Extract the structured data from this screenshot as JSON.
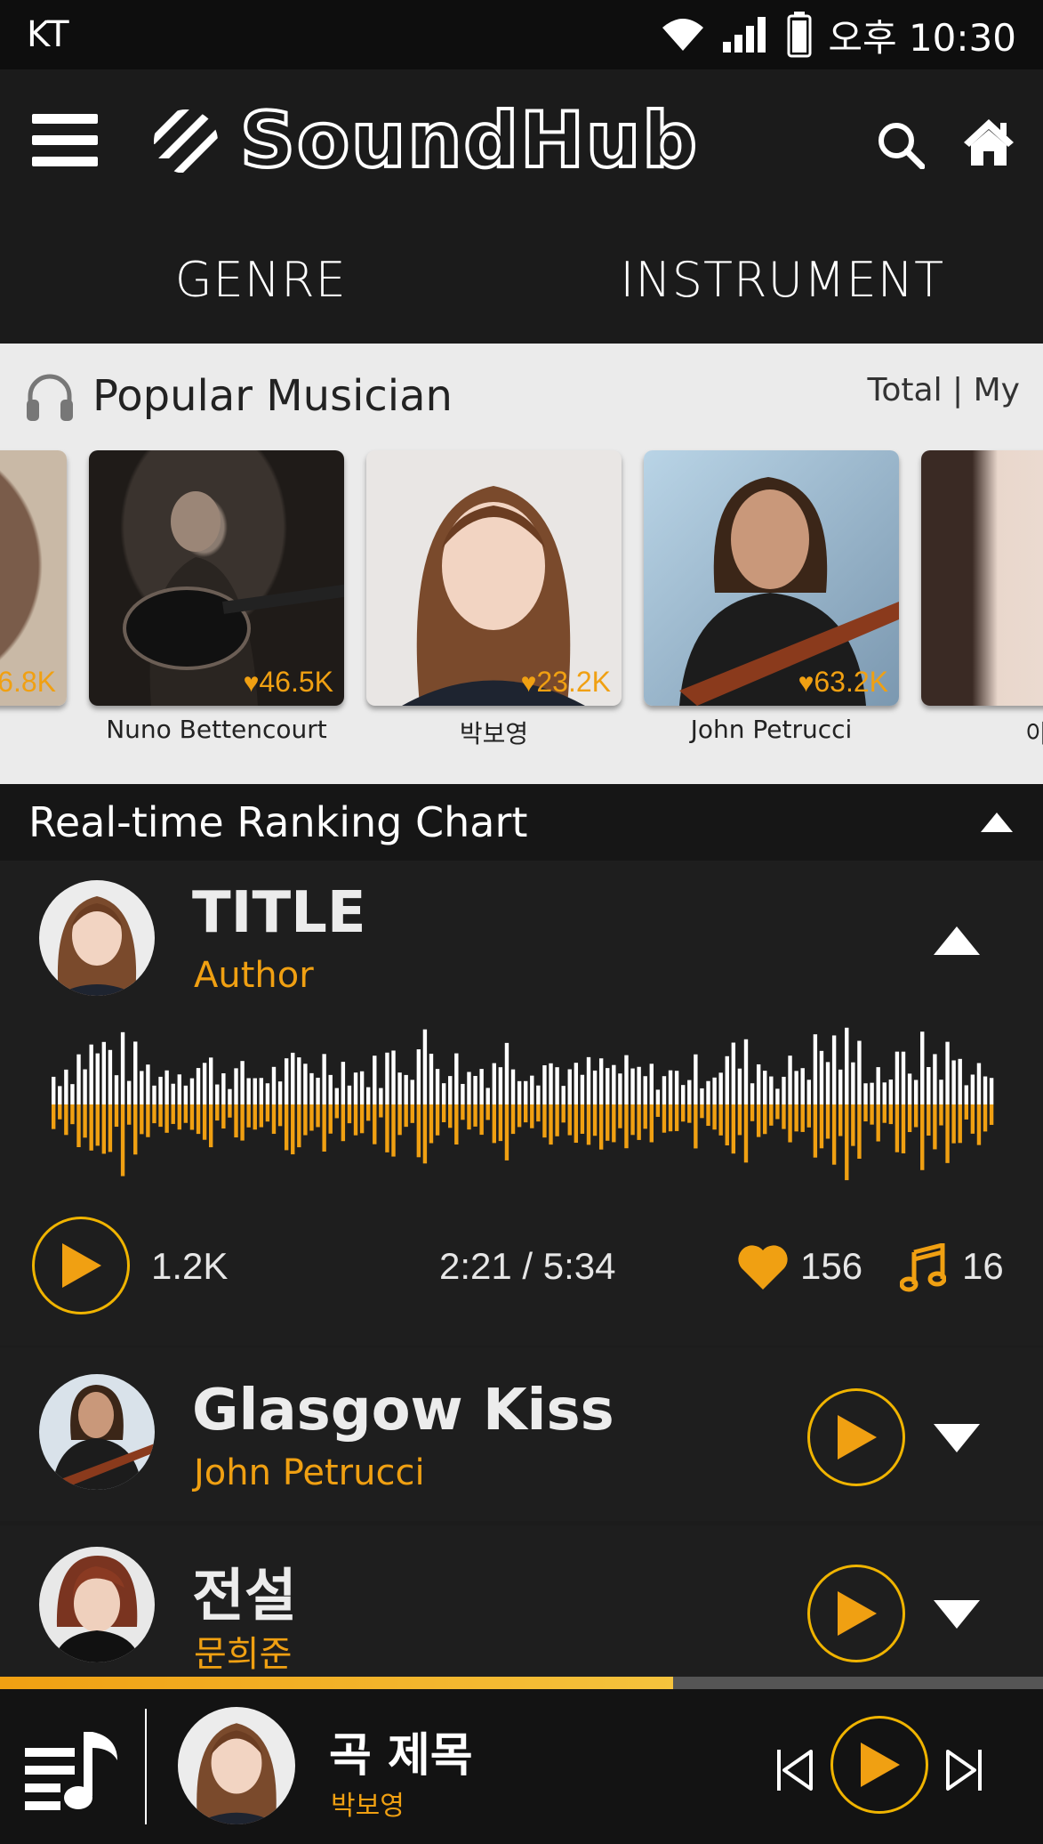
{
  "status_bar": {
    "carrier": "KT",
    "time": "오후 10:30"
  },
  "app": {
    "name": "SoundHub"
  },
  "tabs": [
    {
      "label": "GENRE"
    },
    {
      "label": "INSTRUMENT"
    }
  ],
  "popular": {
    "title": "Popular Musician",
    "filter_total": "Total",
    "filter_sep": "|",
    "filter_my": "My",
    "musicians": [
      {
        "name": "",
        "likes": "6.8K"
      },
      {
        "name": "Nuno Bettencourt",
        "likes": "46.5K"
      },
      {
        "name": "박보영",
        "likes": "23.2K"
      },
      {
        "name": "John Petrucci",
        "likes": "63.2K"
      },
      {
        "name": "아이",
        "likes": ""
      }
    ]
  },
  "ranking": {
    "title": "Real-time Ranking Chart",
    "expanded": {
      "title": "TITLE",
      "author": "Author",
      "plays": "1.2K",
      "time": "2:21 / 5:34",
      "likes": "156",
      "notes": "16"
    },
    "tracks": [
      {
        "title": "Glasgow Kiss",
        "artist": "John Petrucci"
      },
      {
        "title": "전설",
        "artist": "문희준"
      }
    ]
  },
  "player": {
    "title": "곡 제목",
    "artist": "박보영",
    "progress": 0.645
  },
  "colors": {
    "accent": "#f0a012",
    "ring": "#f0b400",
    "background": "#1e1e1e"
  }
}
